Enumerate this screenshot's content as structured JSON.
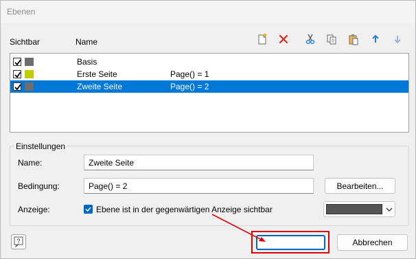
{
  "window": {
    "title": "Ebenen"
  },
  "headers": {
    "visible": "Sichtbar",
    "name": "Name"
  },
  "toolbar": [
    {
      "icon": "new-layer-icon"
    },
    {
      "icon": "delete-icon"
    },
    {
      "icon": "cut-icon"
    },
    {
      "icon": "copy-icon"
    },
    {
      "icon": "paste-icon"
    },
    {
      "icon": "arrow-up-icon"
    },
    {
      "icon": "arrow-down-icon"
    }
  ],
  "layers": [
    {
      "visible": true,
      "color": "#6e6e6e",
      "name": "Basis",
      "condition": "",
      "selected": false
    },
    {
      "visible": true,
      "color": "#c0cc00",
      "name": "Erste Seite",
      "condition": "Page() = 1",
      "selected": false
    },
    {
      "visible": true,
      "color": "#6e6e6e",
      "name": "Zweite Seite",
      "condition": "Page() = 2",
      "selected": true
    }
  ],
  "settings": {
    "group_label": "Einstellungen",
    "name_label": "Name:",
    "name_value": "Zweite Seite",
    "condition_label": "Bedingung:",
    "condition_value": "Page() = 2",
    "edit_button": "Bearbeiten...",
    "display_label": "Anzeige:",
    "display_checkbox_checked": true,
    "display_checkbox_label": "Ebene ist in der gegenwärtigen Anzeige sichtbar",
    "display_color": "#555555"
  },
  "footer": {
    "ok_label": "",
    "cancel_label": "Abbrechen"
  },
  "colors": {
    "selection": "#0078d7",
    "accent": "#0067c0",
    "annotation": "#e00000"
  }
}
